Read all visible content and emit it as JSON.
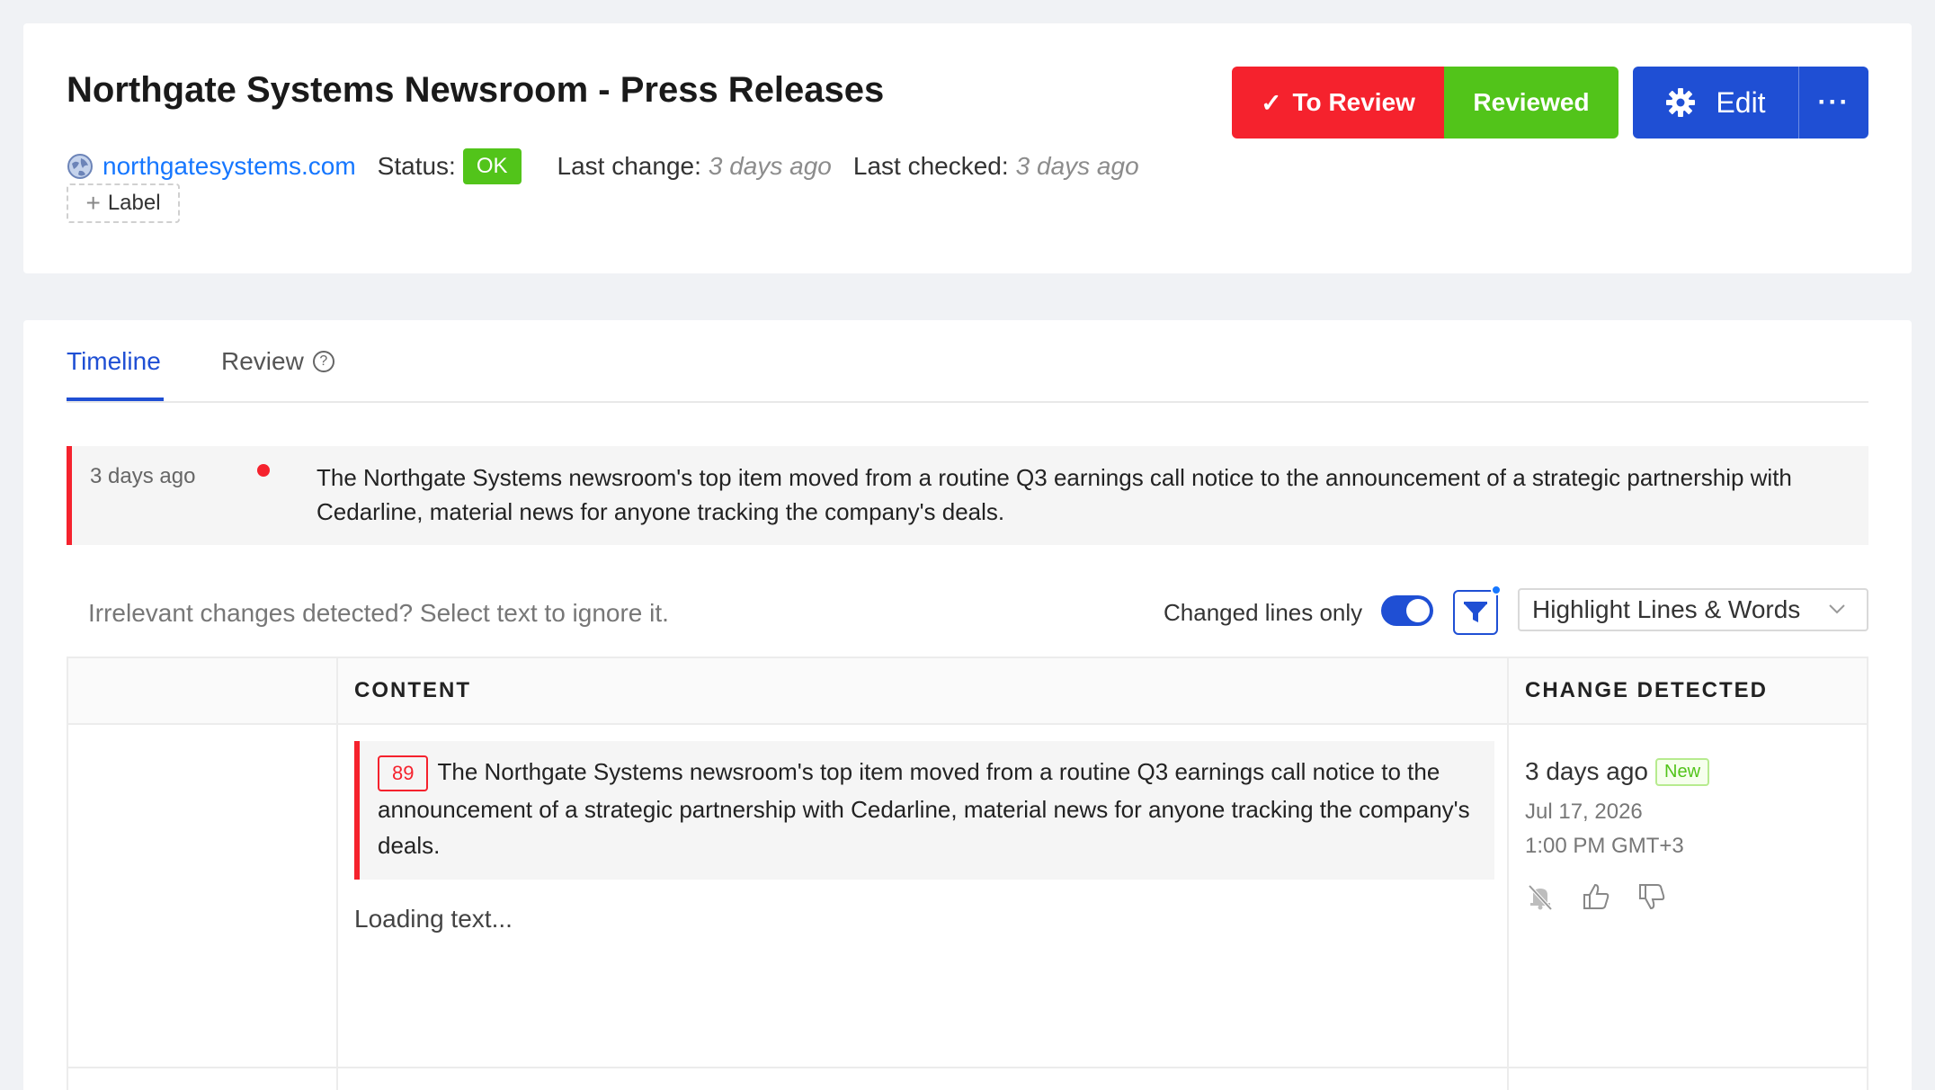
{
  "header": {
    "title": "Northgate Systems Newsroom - Press Releases",
    "site": "northgatesystems.com",
    "status_label": "Status:",
    "status_value": "OK",
    "last_change_label": "Last change:",
    "last_change_value": "3 days ago",
    "last_checked_label": "Last checked:",
    "last_checked_value": "3 days ago",
    "label_button": "Label",
    "to_review_button": "To Review",
    "reviewed_button": "Reviewed",
    "edit_button": "Edit",
    "more_button": "···"
  },
  "tabs": [
    {
      "label": "Timeline",
      "active": true
    },
    {
      "label": "Review",
      "active": false
    }
  ],
  "summary": {
    "time": "3 days ago",
    "text": "The Northgate Systems newsroom's top item moved from a routine Q3 earnings call notice to the announcement of a strategic partnership with Cedarline, material news for anyone tracking the company's deals."
  },
  "toolbar": {
    "hint": "Irrelevant changes detected? Select text to ignore it.",
    "changed_lines_label": "Changed lines only",
    "changed_lines_on": true,
    "highlight_select": "Highlight Lines & Words"
  },
  "table": {
    "columns": [
      "",
      "CONTENT",
      "CHANGE DETECTED"
    ],
    "row": {
      "line_number": "89",
      "content": "The Northgate Systems newsroom's top item moved from a routine Q3 earnings call notice to the announcement of a strategic partnership with Cedarline, material news for anyone tracking the company's deals.",
      "loading": "Loading text...",
      "detected_ago": "3 days ago",
      "badge": "New",
      "date": "Jul 17, 2026",
      "time": "1:00 PM GMT+3"
    }
  },
  "colors": {
    "accent": "#1f4fd4",
    "danger": "#f5222d",
    "success": "#52c41a",
    "link": "#1677ff"
  }
}
